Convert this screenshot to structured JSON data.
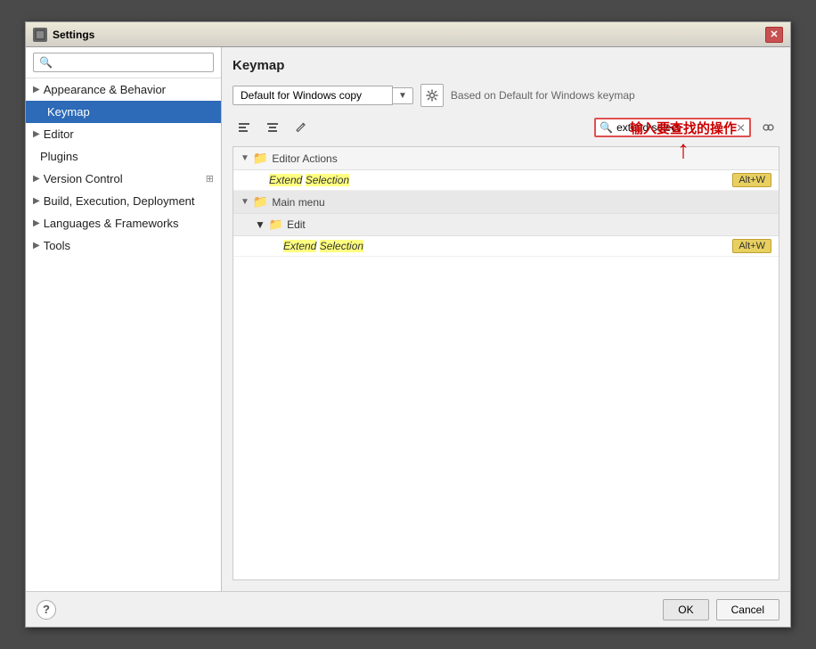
{
  "window": {
    "title": "Settings",
    "title_icon": "⚙"
  },
  "sidebar": {
    "search_placeholder": "🔍",
    "items": [
      {
        "id": "appearance",
        "label": "Appearance & Behavior",
        "level": 0,
        "expandable": true,
        "active": false
      },
      {
        "id": "keymap",
        "label": "Keymap",
        "level": 1,
        "expandable": false,
        "active": true
      },
      {
        "id": "editor",
        "label": "Editor",
        "level": 0,
        "expandable": true,
        "active": false
      },
      {
        "id": "plugins",
        "label": "Plugins",
        "level": 0,
        "expandable": false,
        "active": false
      },
      {
        "id": "version-control",
        "label": "Version Control",
        "level": 0,
        "expandable": true,
        "active": false
      },
      {
        "id": "build",
        "label": "Build, Execution, Deployment",
        "level": 0,
        "expandable": true,
        "active": false
      },
      {
        "id": "languages",
        "label": "Languages & Frameworks",
        "level": 0,
        "expandable": true,
        "active": false
      },
      {
        "id": "tools",
        "label": "Tools",
        "level": 0,
        "expandable": true,
        "active": false
      }
    ]
  },
  "main": {
    "section_title": "Keymap",
    "keymap_dropdown_value": "Default for Windows copy",
    "keymap_info": "Based on Default for Windows keymap",
    "search_value": "extend select",
    "search_placeholder": "extend select",
    "tree": {
      "groups": [
        {
          "id": "editor-actions",
          "name": "Editor Actions",
          "expanded": true,
          "items": [
            {
              "name": "Extend Selection",
              "shortcut": "Alt+W"
            }
          ]
        },
        {
          "id": "main-menu",
          "name": "Main menu",
          "expanded": true,
          "subgroups": [
            {
              "id": "edit",
              "name": "Edit",
              "expanded": true,
              "items": [
                {
                  "name": "Extend Selection",
                  "shortcut": "Alt+W"
                }
              ]
            }
          ]
        }
      ]
    }
  },
  "toolbar": {
    "align_left_label": "≡",
    "align_center_label": "⁼",
    "edit_label": "✏"
  },
  "annotation": {
    "text": "输入要查找的操作",
    "arrow": "↑"
  },
  "bottom": {
    "help_label": "?",
    "ok_label": "OK",
    "cancel_label": "Cancel"
  }
}
